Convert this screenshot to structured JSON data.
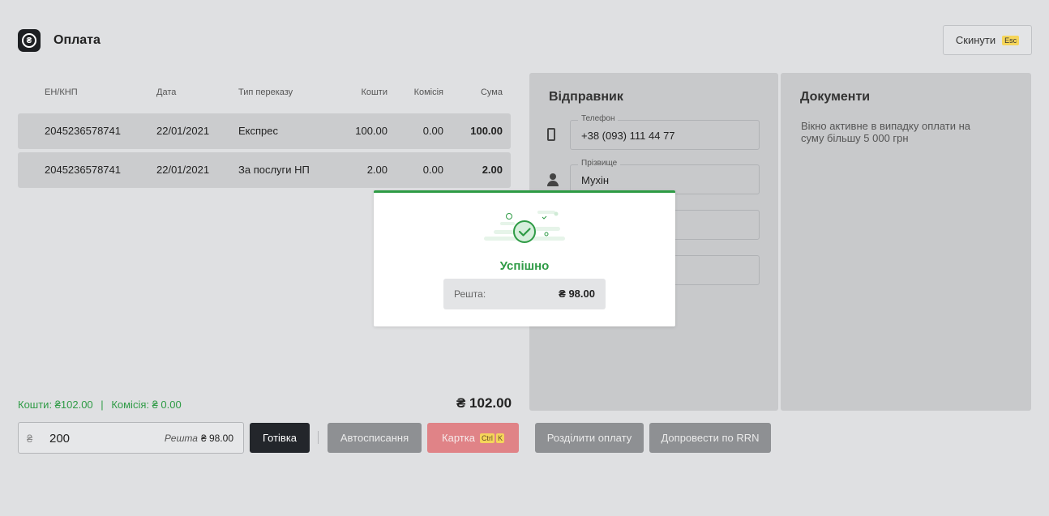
{
  "header": {
    "title": "Оплата",
    "currency_glyph": "₴"
  },
  "reset": {
    "label": "Скинути",
    "shortcut": "Esc"
  },
  "table": {
    "columns": [
      "ЕН/КНП",
      "Дата",
      "Тип переказу",
      "Кошти",
      "Комісія",
      "Сума"
    ],
    "rows": [
      {
        "en": "2045236578741",
        "date": "22/01/2021",
        "type": "Експрес",
        "funds": "100.00",
        "commission": "0.00",
        "sum": "100.00"
      },
      {
        "en": "2045236578741",
        "date": "22/01/2021",
        "type": "За послуги НП",
        "funds": "2.00",
        "commission": "0.00",
        "sum": "2.00"
      }
    ]
  },
  "sender": {
    "title": "Відправник",
    "phone": {
      "label": "Телефон",
      "value": "+38 (093) 111 44 77"
    },
    "surname": {
      "label": "Прізвище",
      "value": "Мухін"
    }
  },
  "documents": {
    "title": "Документи",
    "note": "Вікно активне в випадку оплати на суму більшу 5 000 грн"
  },
  "summary": {
    "funds": "Кошти: ₴102.00",
    "separator": "|",
    "commission": "Комісія: ₴ 0.00",
    "total": "₴ 102.00"
  },
  "payment": {
    "currency": "₴",
    "amount": "200",
    "rest_label": "Решта",
    "rest_value": "₴ 98.00"
  },
  "buttons": {
    "cash": "Готівка",
    "auto": "Автосписання",
    "card": "Картка",
    "card_kbd_1": "Ctrl",
    "card_kbd_2": "K",
    "split": "Розділити оплату",
    "rrn": "Допровести по RRN"
  },
  "modal": {
    "status": "Успішно",
    "change_label": "Решта:",
    "change_value": "₴ 98.00",
    "icon": "success-check-icon"
  },
  "colors": {
    "success": "#2e9b45",
    "primary_dark": "#23262b",
    "card_button": "#e08387",
    "disabled_button": "#8e9093",
    "shortcut_badge": "#f5d55a"
  }
}
